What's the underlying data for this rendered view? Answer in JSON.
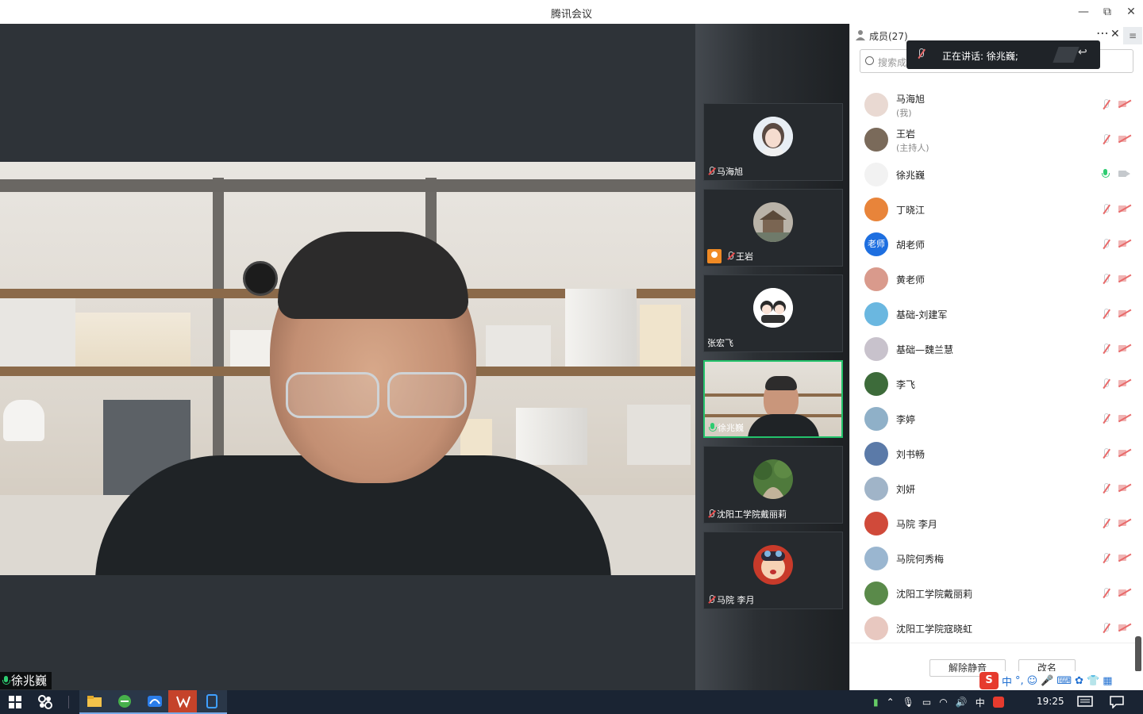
{
  "window": {
    "title": "腾讯会议",
    "minimize": "—",
    "maximize": "⧉",
    "close": "✕"
  },
  "main_video": {
    "speaker_name": "徐兆巍"
  },
  "thumbnails": [
    {
      "name": "马海旭",
      "mic": "muted",
      "host": false,
      "active": false,
      "avatar": "girl-avatar"
    },
    {
      "name": "王岩",
      "mic": "muted",
      "host": true,
      "active": false,
      "avatar": "pavilion-avatar"
    },
    {
      "name": "张宏飞",
      "mic": "none",
      "host": false,
      "active": false,
      "avatar": "couple-avatar"
    },
    {
      "name": "徐兆巍",
      "mic": "on",
      "host": false,
      "active": true,
      "avatar": "video"
    },
    {
      "name": "沈阳工学院戴丽莉",
      "mic": "muted",
      "host": false,
      "active": false,
      "avatar": "nature-avatar"
    },
    {
      "name": "马院 李月",
      "mic": "muted",
      "host": false,
      "active": false,
      "avatar": "cartoon-avatar"
    }
  ],
  "panel": {
    "header_label": "成员(27)",
    "more": "⋯",
    "close": "✕",
    "menu": "≡",
    "search_placeholder": "搜索成员",
    "speaking_tip": "正在讲话: 徐兆巍;",
    "members": [
      {
        "name": "马海旭",
        "sub": "(我)",
        "mic": "muted",
        "cam": "off",
        "avatar_color": "#e9d9d2"
      },
      {
        "name": "王岩",
        "sub": "(主持人)",
        "mic": "muted",
        "cam": "off",
        "avatar_color": "#7a6a5a"
      },
      {
        "name": "徐兆巍",
        "sub": "",
        "mic": "on",
        "cam": "on",
        "avatar_color": "#f2f2f2"
      },
      {
        "name": "丁晓江",
        "sub": "",
        "mic": "muted",
        "cam": "off",
        "avatar_color": "#e8843a"
      },
      {
        "name": "胡老师",
        "sub": "",
        "mic": "muted",
        "cam": "off",
        "avatar_color": "#1e6fe0",
        "avatar_text": "老师"
      },
      {
        "name": "黄老师",
        "sub": "",
        "mic": "muted",
        "cam": "off",
        "avatar_color": "#d99a8c"
      },
      {
        "name": "基础-刘建军",
        "sub": "",
        "mic": "muted",
        "cam": "off",
        "avatar_color": "#6ab7e0"
      },
      {
        "name": "基础—魏兰慧",
        "sub": "",
        "mic": "muted",
        "cam": "off",
        "avatar_color": "#c8c2cc"
      },
      {
        "name": "李飞",
        "sub": "",
        "mic": "muted",
        "cam": "off",
        "avatar_color": "#3d6b3a"
      },
      {
        "name": "李婷",
        "sub": "",
        "mic": "muted",
        "cam": "off",
        "avatar_color": "#8fb0c8"
      },
      {
        "name": "刘书畅",
        "sub": "",
        "mic": "muted",
        "cam": "off",
        "avatar_color": "#5b7aa8"
      },
      {
        "name": "刘妍",
        "sub": "",
        "mic": "muted",
        "cam": "off",
        "avatar_color": "#a0b4c8"
      },
      {
        "name": "马院 李月",
        "sub": "",
        "mic": "muted",
        "cam": "off",
        "avatar_color": "#d04a3a"
      },
      {
        "name": "马院何秀梅",
        "sub": "",
        "mic": "muted",
        "cam": "off",
        "avatar_color": "#9ab6d0"
      },
      {
        "name": "沈阳工学院戴丽莉",
        "sub": "",
        "mic": "muted",
        "cam": "off",
        "avatar_color": "#5a8a4a"
      },
      {
        "name": "沈阳工学院寇晓虹",
        "sub": "",
        "mic": "muted",
        "cam": "off",
        "avatar_color": "#e8c8c0"
      }
    ],
    "unmute_button": "解除静音",
    "rename_button": "改名"
  },
  "ime": {
    "logo": "S",
    "lang": "中",
    "punct": "°,"
  },
  "taskbar": {
    "clock": "19:25",
    "ime_indicator": "中"
  }
}
